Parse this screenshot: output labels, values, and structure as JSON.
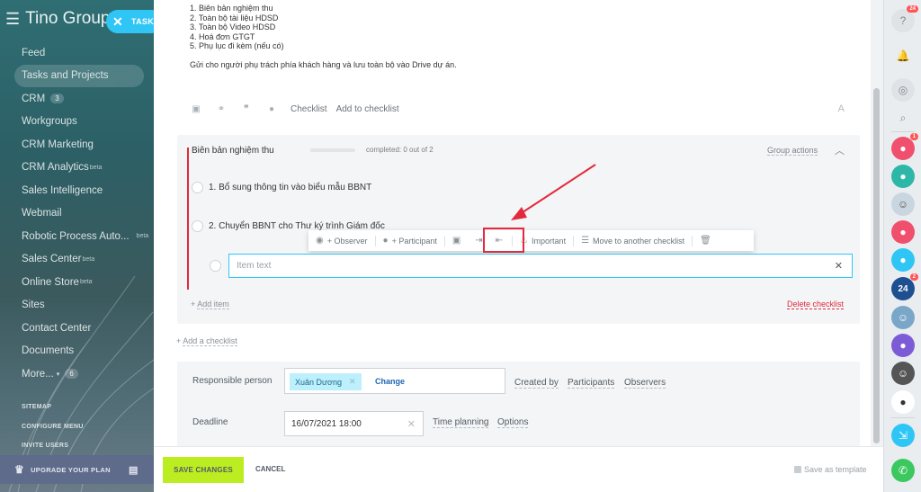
{
  "sidebar": {
    "brand": "Tino Group",
    "task_button": "TASK",
    "items": [
      {
        "label": "Feed"
      },
      {
        "label": "Tasks and Projects",
        "active": true
      },
      {
        "label": "CRM",
        "badge": "3"
      },
      {
        "label": "Workgroups"
      },
      {
        "label": "CRM Marketing"
      },
      {
        "label": "CRM Analytics",
        "sup": "beta"
      },
      {
        "label": "Sales Intelligence"
      },
      {
        "label": "Webmail"
      },
      {
        "label": "Robotic Process Auto...",
        "sup": "beta"
      },
      {
        "label": "Sales Center",
        "sup": "beta"
      },
      {
        "label": "Online Store",
        "sup": "beta"
      },
      {
        "label": "Sites"
      },
      {
        "label": "Contact Center"
      },
      {
        "label": "Documents"
      },
      {
        "label": "More...",
        "badge": "6"
      }
    ],
    "sitemap": "SITEMAP",
    "configure_menu": "CONFIGURE MENU",
    "invite_users": "INVITE USERS",
    "upgrade": "UPGRADE YOUR PLAN"
  },
  "description": {
    "lines": [
      "1. Biên bản nghiệm thu",
      "2. Toàn bộ tài liệu HDSD",
      "3. Toàn bộ Video HDSD",
      "4. Hoá đơn GTGT",
      "5. Phụ lục đi kèm (nếu có)"
    ],
    "note": "Gửi cho người phụ trách phía khách hàng và lưu toàn bộ vào Drive dự án."
  },
  "editor_toolbar": {
    "checklist": "Checklist",
    "add_to_checklist": "Add to checklist",
    "font_button": "A"
  },
  "checklist": {
    "title": "Biên bản nghiệm thu",
    "completed": "completed: 0 out of 2",
    "progress": 0,
    "group_actions": "Group actions",
    "items": [
      {
        "text": "1. Bổ sung thông tin vào biểu mẫu BBNT"
      },
      {
        "text": "2. Chuyển BBNT cho Thư ký trình Giám đốc"
      }
    ],
    "item_placeholder": "Item text",
    "add_item": "Add item",
    "delete": "Delete checklist",
    "add_checklist": "Add a checklist"
  },
  "float_toolbar": {
    "observer": "+ Observer",
    "participant": "+ Participant",
    "important": "Important",
    "move": "Move to another checklist"
  },
  "fields": {
    "responsible_label": "Responsible person",
    "responsible_value": "Xuân Dương",
    "change": "Change",
    "created_by": "Created by",
    "participants": "Participants",
    "observers": "Observers",
    "deadline_label": "Deadline",
    "deadline_value": "16/07/2021 18:00",
    "time_planning": "Time planning",
    "options": "Options"
  },
  "footer": {
    "save": "SAVE CHANGES",
    "cancel": "CANCEL",
    "save_template": "Save as template"
  },
  "rightbar": {
    "help_count": "24",
    "chat_count": "1",
    "b24_label": "24",
    "b24_count": "2"
  },
  "colors": {
    "accent": "#2fc6f6",
    "save_green": "#bbed21",
    "danger": "#e3293b"
  }
}
